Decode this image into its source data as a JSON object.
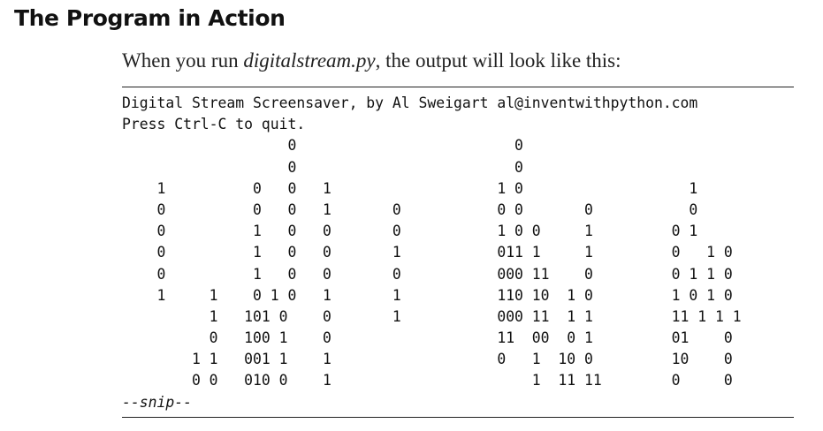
{
  "section": {
    "title": "The Program in Action",
    "intro_prefix": "When you run ",
    "intro_filename": "digitalstream.py",
    "intro_suffix": ", the output will look like this:"
  },
  "output": {
    "lines": [
      "Digital Stream Screensaver, by Al Sweigart al@inventwithpython.com",
      "Press Ctrl-C to quit.",
      "                   0                         0",
      "                   0                         0",
      "    1          0   0   1                   1 0                   1",
      "    0          0   0   1       0           0 0       0           0",
      "    0          1   0   0       0           1 0 0     1         0 1",
      "    0          1   0   0       1           011 1     1         0   1 0",
      "    0          1   0   0       0           000 11    0         0 1 1 0",
      "    1     1    0 1 0   1       1           110 10  1 0         1 0 1 0",
      "          1   101 0    0       1           000 11  1 1         11 1 1 1",
      "          0   100 1    0                   11  00  0 1         01    0",
      "        1 1   001 1    1                   0   1  10 0         10    0",
      "        0 0   010 0    1                       1  11 11        0     0"
    ],
    "snip": "--snip--"
  }
}
